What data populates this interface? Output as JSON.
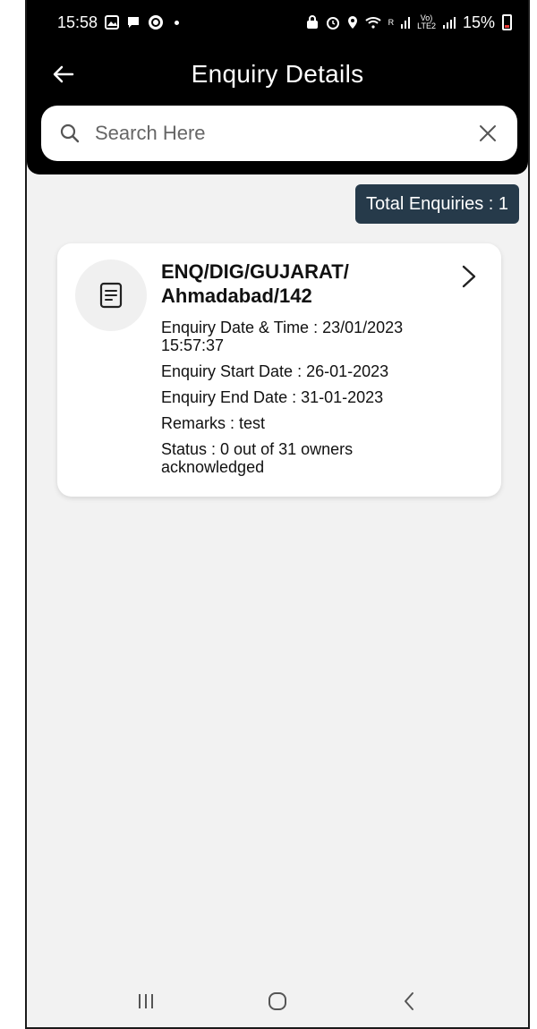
{
  "status_bar": {
    "time": "15:58",
    "battery": "15%",
    "net_top": "Vo)",
    "net_bottom": "LTE2",
    "roam": "R"
  },
  "header": {
    "title": "Enquiry Details"
  },
  "search": {
    "placeholder": "Search Here"
  },
  "summary": {
    "total_label": "Total Enquiries : 1"
  },
  "enquiries": [
    {
      "title_line1": "ENQ/DIG/GUJARAT/",
      "title_line2": "Ahmadabad/142",
      "date_time_line1": "Enquiry Date & Time : 23/01/2023",
      "date_time_line2": "15:57:37",
      "start_date": "Enquiry Start Date : 26-01-2023",
      "end_date": "Enquiry End Date : 31-01-2023",
      "remarks": "Remarks : test",
      "status_line1": "Status : 0 out of 31 owners",
      "status_line2": "acknowledged"
    }
  ],
  "colors": {
    "header_bg": "#000000",
    "badge_bg": "#263a4a",
    "page_bg": "#f2f2f2"
  }
}
